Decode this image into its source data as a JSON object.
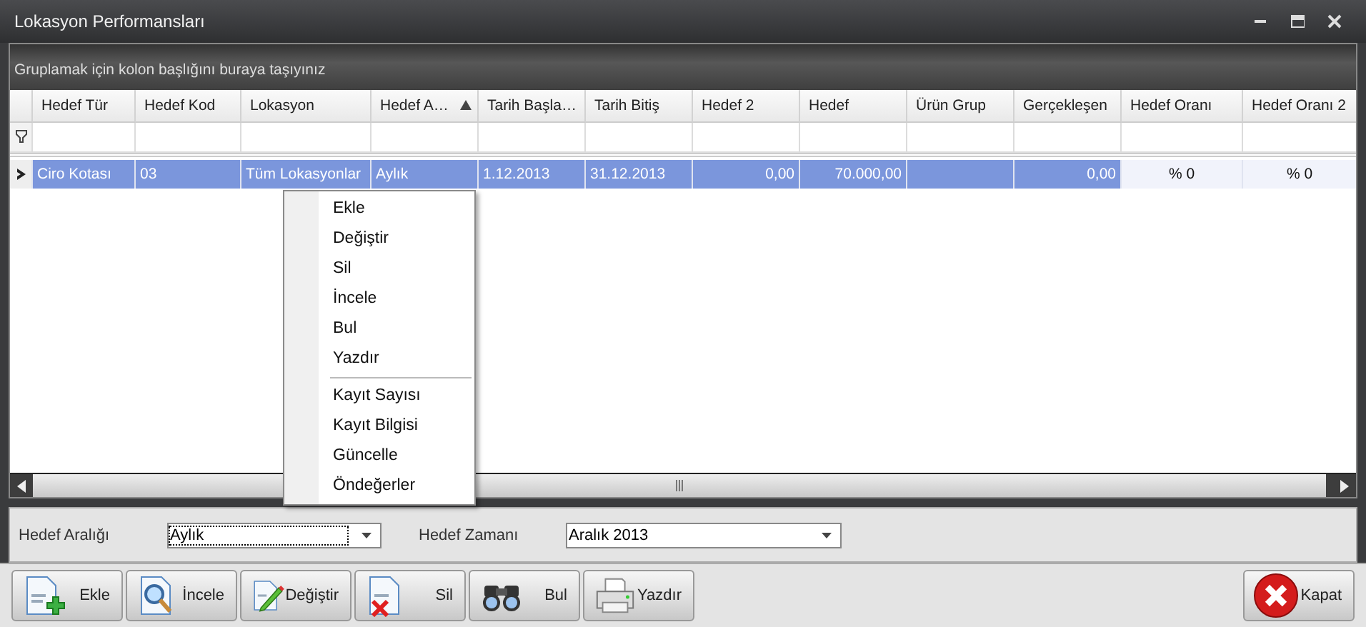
{
  "window": {
    "title": "Lokasyon Performansları"
  },
  "grid": {
    "group_panel": "Gruplamak için kolon başlığını buraya taşıyınız",
    "columns": [
      {
        "label": "Hedef Tür",
        "kind": "text"
      },
      {
        "label": "Hedef Kod",
        "kind": "text"
      },
      {
        "label": "Lokasyon",
        "kind": "text"
      },
      {
        "label": "Hedef A…",
        "kind": "text",
        "sorted": true
      },
      {
        "label": "Tarih Başla…",
        "kind": "text"
      },
      {
        "label": "Tarih Bitiş",
        "kind": "text"
      },
      {
        "label": "Hedef 2",
        "kind": "number"
      },
      {
        "label": "Hedef",
        "kind": "number"
      },
      {
        "label": "Ürün Grup",
        "kind": "text"
      },
      {
        "label": "Gerçekleşen",
        "kind": "number"
      },
      {
        "label": "Hedef Oranı",
        "kind": "percent"
      },
      {
        "label": "Hedef Oranı 2",
        "kind": "percent"
      }
    ],
    "rows": [
      {
        "selected": true,
        "cells": [
          "Ciro Kotası",
          "03",
          "Tüm Lokasyonlar",
          "Aylık",
          "1.12.2013",
          "31.12.2013",
          "0,00",
          "70.000,00",
          "",
          "0,00",
          "% 0",
          "% 0"
        ]
      }
    ]
  },
  "context_menu": {
    "groups": [
      [
        "Ekle",
        "Değiştir",
        "Sil",
        "İncele",
        "Bul",
        "Yazdır"
      ],
      [
        "Kayıt Sayısı",
        "Kayıt Bilgisi",
        "Güncelle",
        "Öndeğerler"
      ]
    ]
  },
  "filters": [
    {
      "label": "Hedef Aralığı",
      "value": "Aylık",
      "focused": true
    },
    {
      "label": "Hedef Zamanı",
      "value": "Aralık 2013",
      "focused": false
    }
  ],
  "buttons": [
    {
      "label": "Ekle",
      "kind": "add"
    },
    {
      "label": "İncele",
      "kind": "view"
    },
    {
      "label": "Değiştir",
      "kind": "edit"
    },
    {
      "label": "Sil",
      "kind": "delete"
    },
    {
      "label": "Bul",
      "kind": "find"
    },
    {
      "label": "Yazdır",
      "kind": "print"
    }
  ],
  "close_button": {
    "label": "Kapat"
  }
}
